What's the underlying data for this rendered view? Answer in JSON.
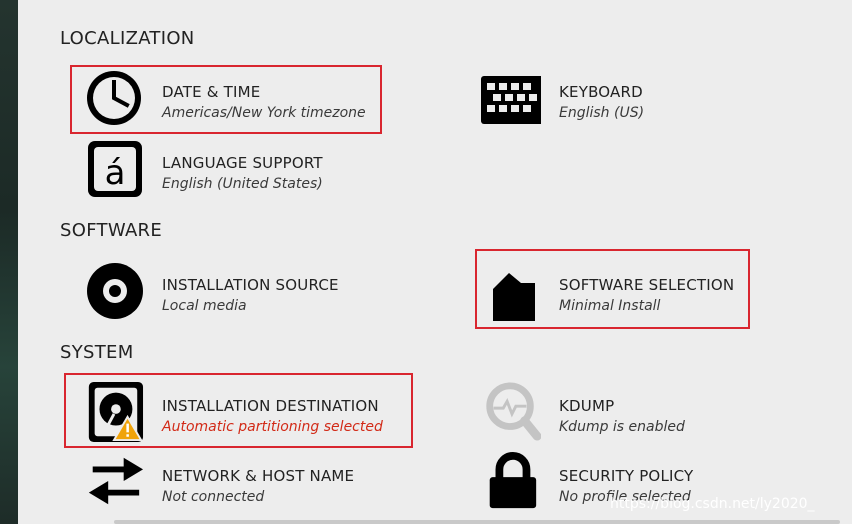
{
  "sections": {
    "localization": "LOCALIZATION",
    "software": "SOFTWARE",
    "system": "SYSTEM"
  },
  "spokes": {
    "date_time": {
      "title": "DATE & TIME",
      "status": "Americas/New York timezone",
      "icon": "clock-icon"
    },
    "keyboard": {
      "title": "KEYBOARD",
      "status": "English (US)",
      "icon": "keyboard-icon"
    },
    "language": {
      "title": "LANGUAGE SUPPORT",
      "status": "English (United States)",
      "icon": "language-icon"
    },
    "install_source": {
      "title": "INSTALLATION SOURCE",
      "status": "Local media",
      "icon": "disc-icon"
    },
    "software_selection": {
      "title": "SOFTWARE SELECTION",
      "status": "Minimal Install",
      "icon": "package-icon"
    },
    "install_destination": {
      "title": "INSTALLATION DESTINATION",
      "status": "Automatic partitioning selected",
      "icon": "harddisk-warning-icon"
    },
    "kdump": {
      "title": "KDUMP",
      "status": "Kdump is enabled",
      "icon": "magnifier-icon"
    },
    "network": {
      "title": "NETWORK & HOST NAME",
      "status": "Not connected",
      "icon": "network-arrows-icon"
    },
    "security": {
      "title": "SECURITY POLICY",
      "status": "No profile selected",
      "icon": "lock-icon"
    }
  },
  "watermark": "https://blog.csdn.net/ly2020_",
  "colors": {
    "highlight": "#d9262f",
    "warning": "#d22a17",
    "panel_bg": "#ededed",
    "icon": "#000000"
  }
}
